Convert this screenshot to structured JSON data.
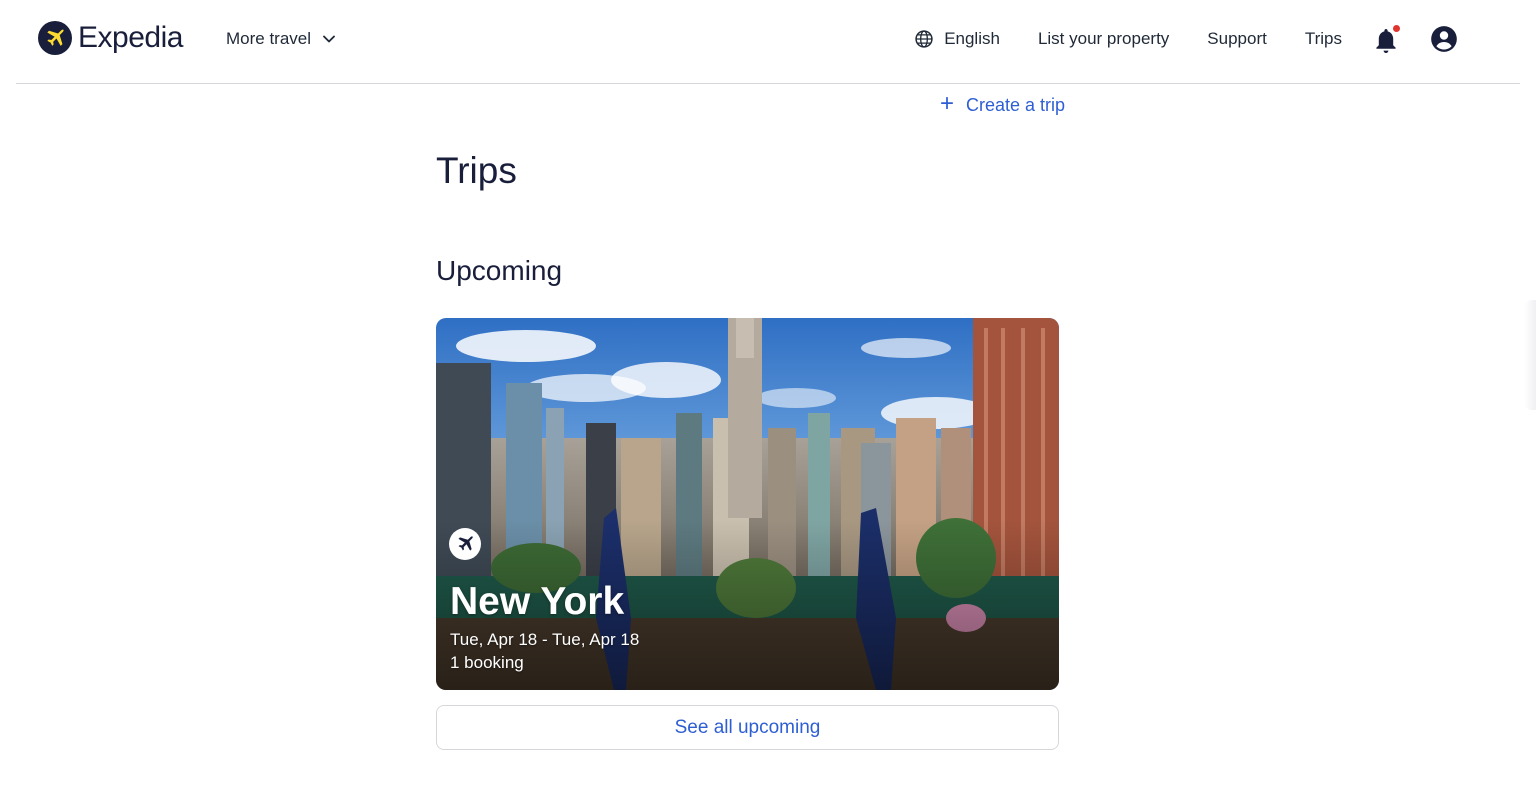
{
  "header": {
    "logo_text": "Expedia",
    "more_travel": "More travel",
    "nav": {
      "language": "English",
      "list_property": "List your property",
      "support": "Support",
      "trips": "Trips"
    },
    "icons": [
      "expedia-logo-icon",
      "chevron-down-icon",
      "globe-icon",
      "bell-icon",
      "account-icon"
    ]
  },
  "main": {
    "create_trip": "Create a trip",
    "page_title": "Trips",
    "section_title": "Upcoming",
    "trip_card": {
      "city": "New York",
      "dates": "Tue, Apr 18 - Tue, Apr 18",
      "bookings": "1 booking",
      "icon": "airplane-icon"
    },
    "see_all": "See all upcoming"
  },
  "colors": {
    "brand_navy": "#191e3b",
    "logo_accent": "#fddb32",
    "link_blue": "#2d5fd3",
    "notification_dot": "#e0342f",
    "divider": "#d6d7db"
  }
}
